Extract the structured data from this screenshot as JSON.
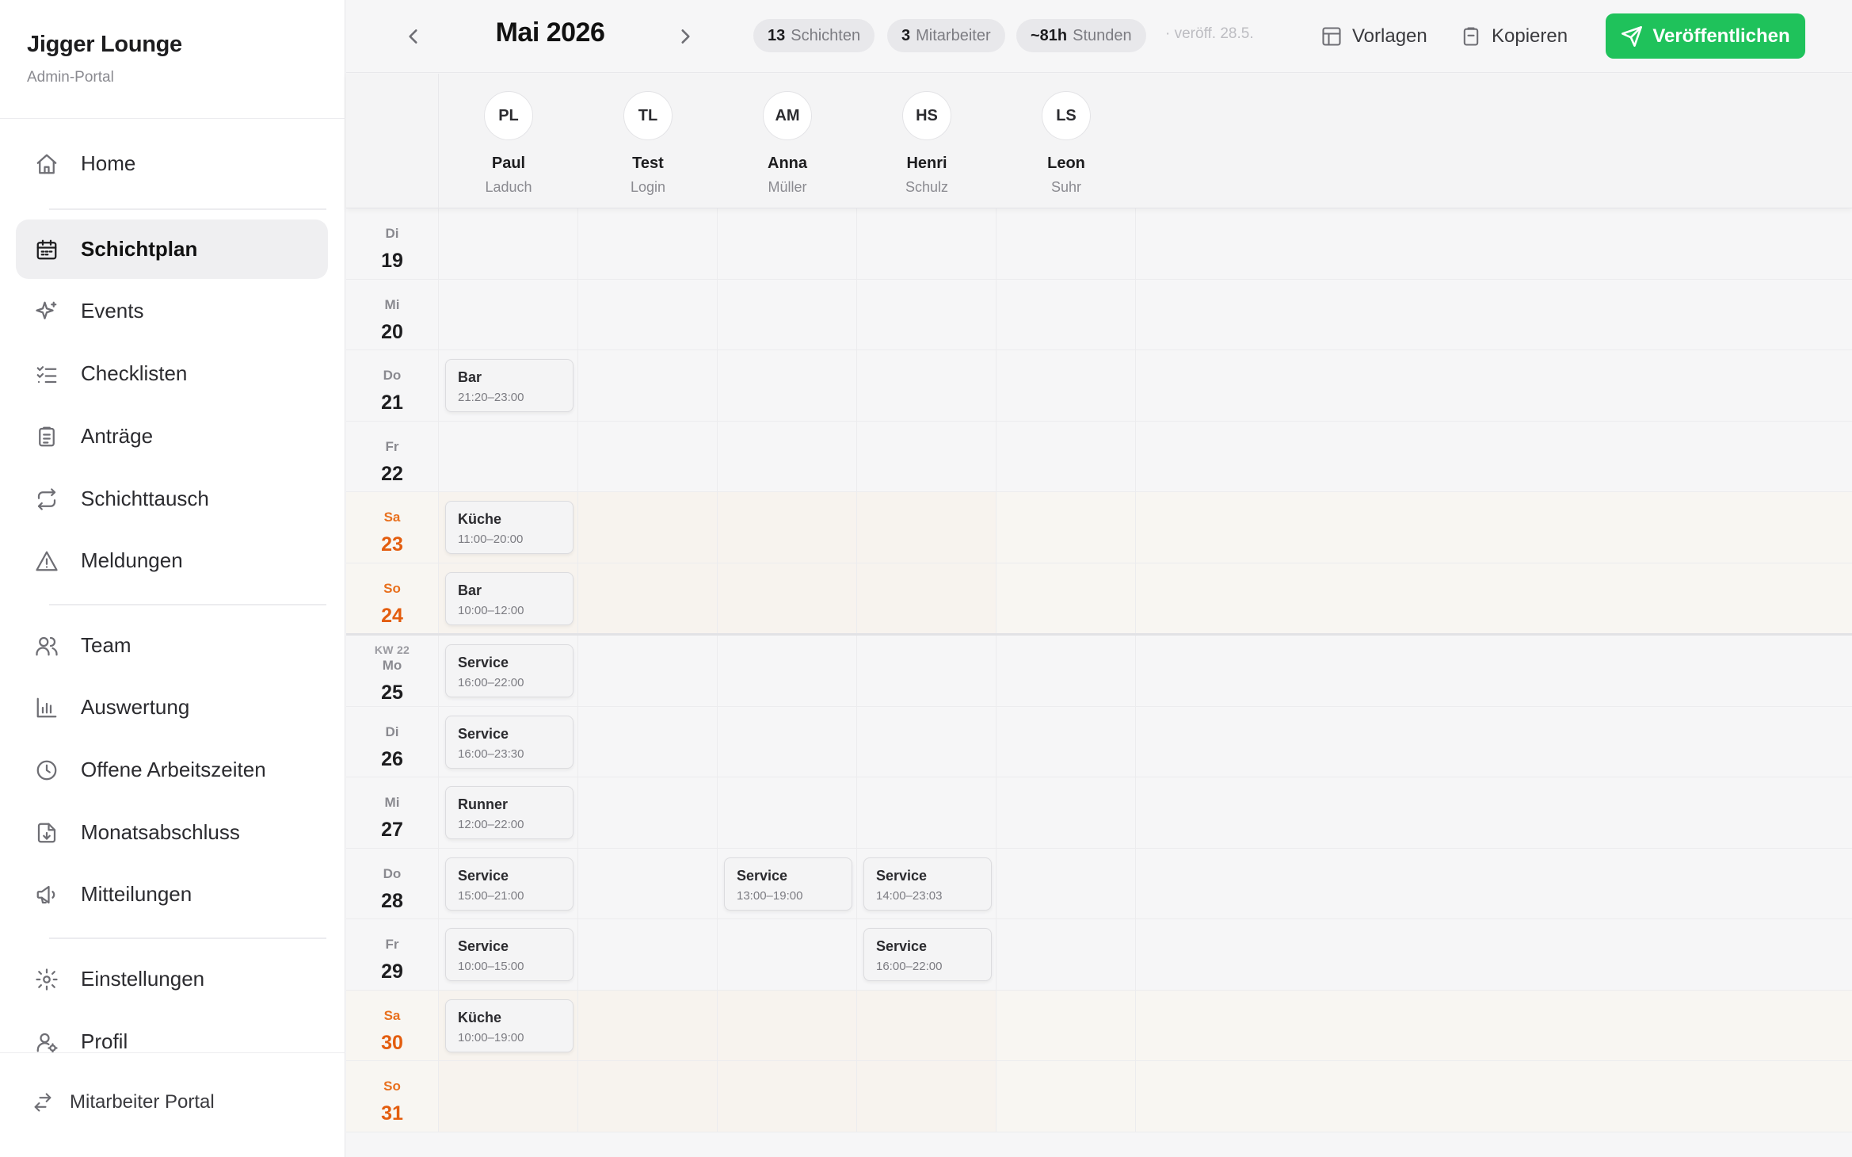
{
  "brand": {
    "title": "Jigger Lounge",
    "subtitle": "Admin-Portal"
  },
  "nav": [
    {
      "label": "Home",
      "icon": "home-icon",
      "active": false
    },
    {
      "label": "Schichtplan",
      "icon": "calendar-icon",
      "active": true
    },
    {
      "label": "Events",
      "icon": "sparkle-icon",
      "active": false
    },
    {
      "label": "Checklisten",
      "icon": "checklist-icon",
      "active": false
    },
    {
      "label": "Anträge",
      "icon": "clipboard-icon",
      "active": false
    },
    {
      "label": "Schichttausch",
      "icon": "swap-icon",
      "active": false
    },
    {
      "label": "Meldungen",
      "icon": "warning-icon",
      "active": false
    },
    {
      "label": "Team",
      "icon": "users-icon",
      "active": false
    },
    {
      "label": "Auswertung",
      "icon": "bar-chart-icon",
      "active": false
    },
    {
      "label": "Offene Arbeitszeiten",
      "icon": "clock-icon",
      "active": false
    },
    {
      "label": "Monatsabschluss",
      "icon": "file-download-icon",
      "active": false
    },
    {
      "label": "Mitteilungen",
      "icon": "megaphone-icon",
      "active": false
    },
    {
      "label": "Einstellungen",
      "icon": "gear-icon",
      "active": false
    },
    {
      "label": "Profil",
      "icon": "user-gear-icon",
      "active": false
    }
  ],
  "footer": {
    "label": "Mitarbeiter Portal",
    "icon": "switch-arrows-icon"
  },
  "topbar": {
    "month": "Mai 2026",
    "stats": [
      {
        "value": "13",
        "label": "Schichten"
      },
      {
        "value": "3",
        "label": "Mitarbeiter"
      },
      {
        "value": "~81h",
        "label": "Stunden"
      }
    ],
    "published_note": "· veröff. 28.5.",
    "templates_label": "Vorlagen",
    "copy_label": "Kopieren",
    "publish_label": "Veröffentlichen"
  },
  "employees": [
    {
      "initials": "PL",
      "first": "Paul",
      "last": "Laduch"
    },
    {
      "initials": "TL",
      "first": "Test",
      "last": "Login"
    },
    {
      "initials": "AM",
      "first": "Anna",
      "last": "Müller"
    },
    {
      "initials": "HS",
      "first": "Henri",
      "last": "Schulz"
    },
    {
      "initials": "LS",
      "first": "Leon",
      "last": "Suhr"
    }
  ],
  "days": [
    {
      "dow": "Di",
      "num": "19",
      "weekend": false,
      "kw": "",
      "shifts": []
    },
    {
      "dow": "Mi",
      "num": "20",
      "weekend": false,
      "kw": "",
      "shifts": []
    },
    {
      "dow": "Do",
      "num": "21",
      "weekend": false,
      "kw": "",
      "shifts": [
        {
          "col": 0,
          "title": "Bar",
          "time": "21:20–23:00"
        }
      ]
    },
    {
      "dow": "Fr",
      "num": "22",
      "weekend": false,
      "kw": "",
      "shifts": []
    },
    {
      "dow": "Sa",
      "num": "23",
      "weekend": true,
      "kw": "",
      "shifts": [
        {
          "col": 0,
          "title": "Küche",
          "time": "11:00–20:00"
        }
      ]
    },
    {
      "dow": "So",
      "num": "24",
      "weekend": true,
      "kw": "",
      "shifts": [
        {
          "col": 0,
          "title": "Bar",
          "time": "10:00–12:00"
        }
      ]
    },
    {
      "dow": "Mo",
      "num": "25",
      "weekend": false,
      "kw": "KW 22",
      "shifts": [
        {
          "col": 0,
          "title": "Service",
          "time": "16:00–22:00"
        }
      ]
    },
    {
      "dow": "Di",
      "num": "26",
      "weekend": false,
      "kw": "",
      "shifts": [
        {
          "col": 0,
          "title": "Service",
          "time": "16:00–23:30"
        }
      ]
    },
    {
      "dow": "Mi",
      "num": "27",
      "weekend": false,
      "kw": "",
      "shifts": [
        {
          "col": 0,
          "title": "Runner",
          "time": "12:00–22:00"
        }
      ]
    },
    {
      "dow": "Do",
      "num": "28",
      "weekend": false,
      "kw": "",
      "shifts": [
        {
          "col": 0,
          "title": "Service",
          "time": "15:00–21:00"
        },
        {
          "col": 2,
          "title": "Service",
          "time": "13:00–19:00"
        },
        {
          "col": 3,
          "title": "Service",
          "time": "14:00–23:03"
        }
      ]
    },
    {
      "dow": "Fr",
      "num": "29",
      "weekend": false,
      "kw": "",
      "shifts": [
        {
          "col": 0,
          "title": "Service",
          "time": "10:00–15:00"
        },
        {
          "col": 3,
          "title": "Service",
          "time": "16:00–22:00"
        }
      ]
    },
    {
      "dow": "Sa",
      "num": "30",
      "weekend": true,
      "kw": "",
      "shifts": [
        {
          "col": 0,
          "title": "Küche",
          "time": "10:00–19:00"
        }
      ]
    },
    {
      "dow": "So",
      "num": "31",
      "weekend": true,
      "kw": "",
      "shifts": []
    }
  ],
  "colors": {
    "accent": "#1fc25b",
    "weekend": "#e35d0e"
  }
}
